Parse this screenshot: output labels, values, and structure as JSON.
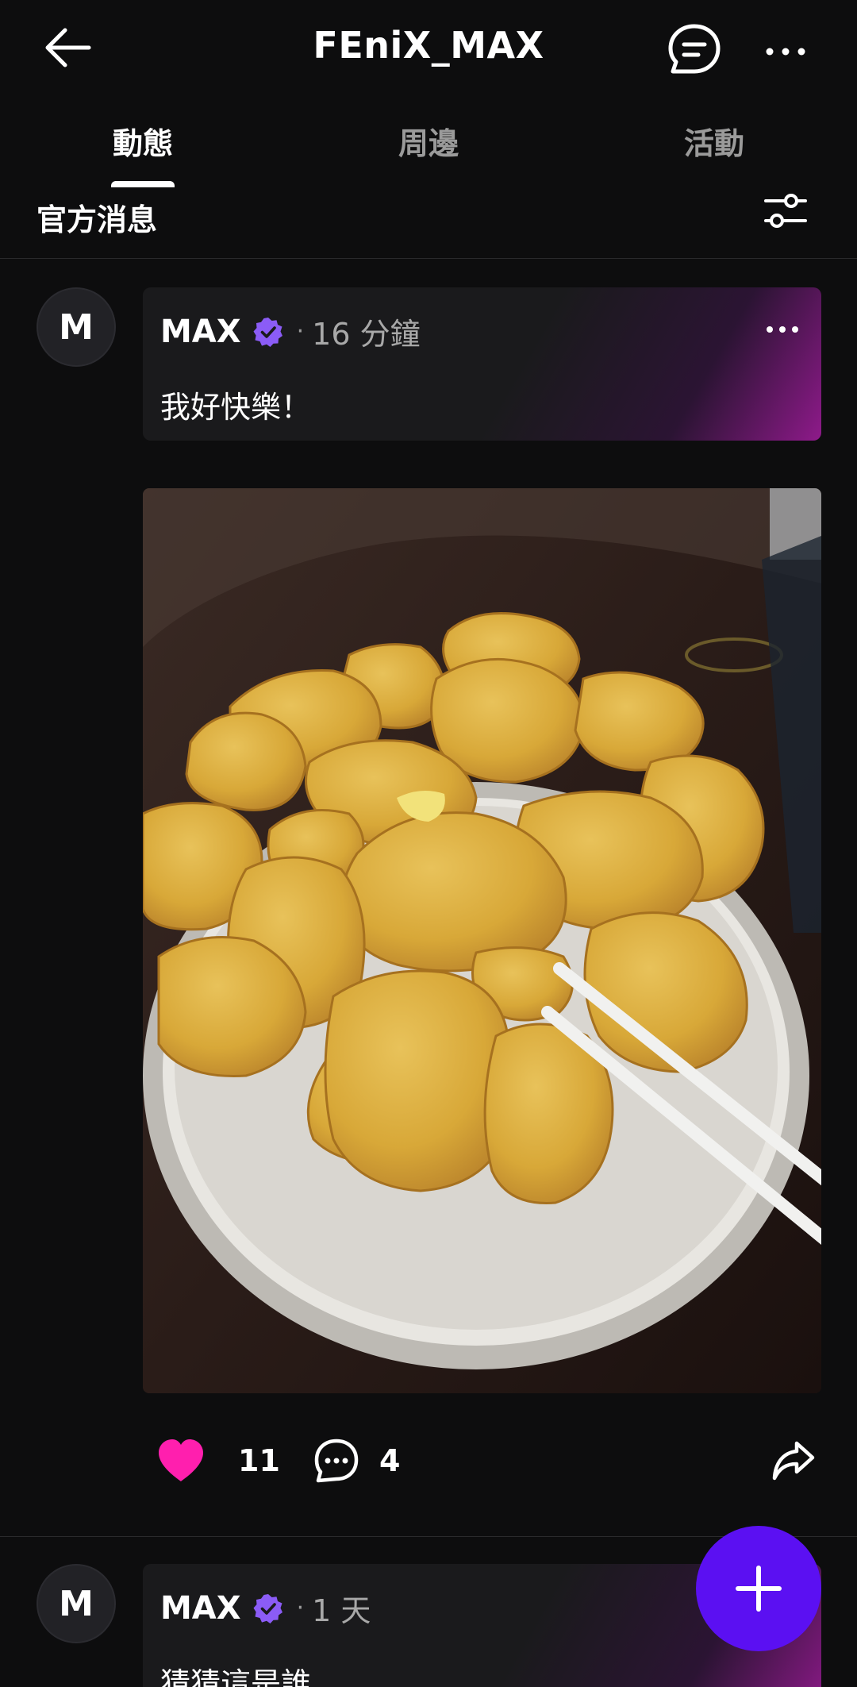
{
  "header": {
    "title": "FEniX_MAX"
  },
  "tabs": [
    {
      "label": "動態"
    },
    {
      "label": "周邊"
    },
    {
      "label": "活動"
    }
  ],
  "subheader": {
    "label": "官方消息"
  },
  "posts": [
    {
      "avatar_letter": "M",
      "author": "MAX",
      "dot": "·",
      "time": "16 分鐘",
      "text": "我好快樂！",
      "likes": "11",
      "comments": "4"
    },
    {
      "avatar_letter": "M",
      "author": "MAX",
      "dot": "·",
      "time": "1 天",
      "text": "猜猜這是誰"
    }
  ],
  "colors": {
    "background": "#0d0d0e",
    "accent_purple": "#5b10f2",
    "verified_badge": "#8b5cf6",
    "like_pink": "#ff1fae"
  },
  "icons": {
    "back": "back-arrow-icon",
    "chat": "chat-bubble-icon",
    "more": "more-dots-icon",
    "filter": "filter-sliders-icon",
    "verified": "verified-badge-icon",
    "like": "heart-icon",
    "comment": "comment-icon",
    "share": "share-icon",
    "add": "plus-icon"
  }
}
